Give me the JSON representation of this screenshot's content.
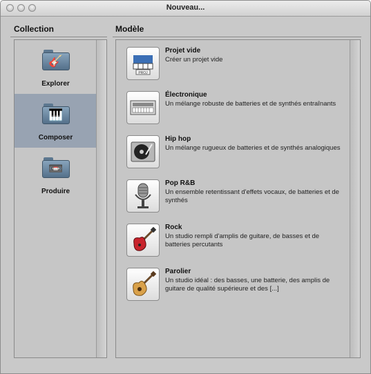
{
  "window": {
    "title": "Nouveau..."
  },
  "collection": {
    "heading": "Collection",
    "items": [
      {
        "label": "Explorer",
        "icon": "guitar-icon",
        "glyph": "🎸",
        "selected": false
      },
      {
        "label": "Composer",
        "icon": "piano-icon",
        "glyph": "🎹",
        "selected": true
      },
      {
        "label": "Produire",
        "icon": "tape-recorder-icon",
        "glyph": "📼",
        "selected": false
      }
    ]
  },
  "model": {
    "heading": "Modèle",
    "templates": [
      {
        "title": "Projet vide",
        "description": "Créer un projet vide",
        "icon": "empty-project-icon",
        "badge": "PROJ"
      },
      {
        "title": "Électronique",
        "description": "Un mélange robuste de batteries et de synthés entraînants",
        "icon": "synth-icon"
      },
      {
        "title": "Hip hop",
        "description": "Un mélange rugueux de batteries et de synthés analogiques",
        "icon": "turntable-icon"
      },
      {
        "title": "Pop R&B",
        "description": "Un ensemble retentissant d'effets vocaux, de batteries et de synthés",
        "icon": "microphone-icon"
      },
      {
        "title": "Rock",
        "description": "Un studio rempli d'amplis de guitare, de basses et de batteries percutants",
        "icon": "electric-guitar-icon"
      },
      {
        "title": "Parolier",
        "description": "Un studio idéal : des basses, une batterie, des amplis de guitare de qualité supérieure et des [...]",
        "icon": "acoustic-guitar-icon"
      }
    ]
  }
}
